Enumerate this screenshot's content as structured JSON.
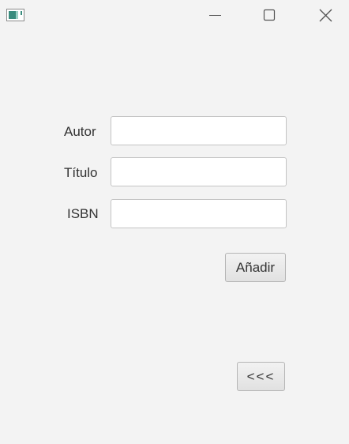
{
  "titlebar": {
    "icon": "java-app-icon",
    "controls": {
      "minimize": "minimize-icon",
      "maximize": "maximize-icon",
      "close": "close-icon"
    }
  },
  "form": {
    "labels": {
      "autor": "Autor",
      "titulo": "Título",
      "isbn": "ISBN"
    },
    "values": {
      "autor": "",
      "titulo": "",
      "isbn": ""
    },
    "add_button": "Añadir",
    "back_button": "<<<"
  }
}
